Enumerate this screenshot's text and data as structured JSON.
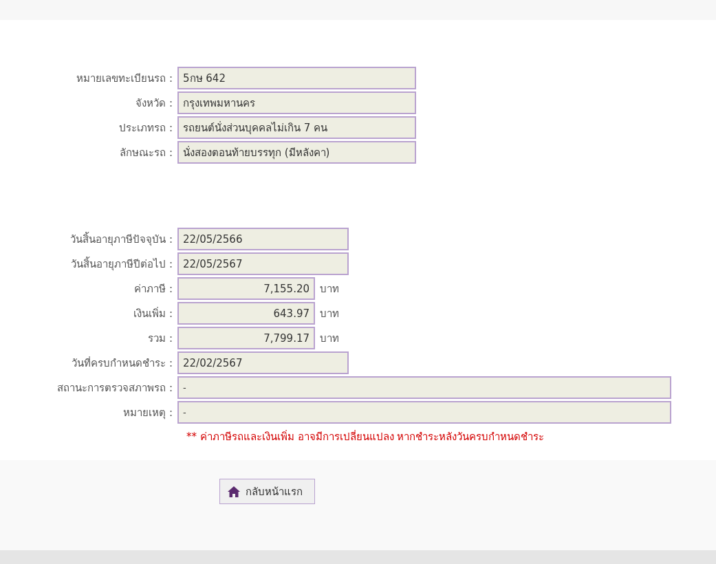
{
  "vehicle_info": [
    {
      "label": "หมายเลขทะเบียนรถ :",
      "value": "5กษ 642",
      "kind": "wide"
    },
    {
      "label": "จังหวัด :",
      "value": "กรุงเทพมหานคร",
      "kind": "wide"
    },
    {
      "label": "ประเภทรถ :",
      "value": "รถยนต์นั่งส่วนบุคคลไม่เกิน 7 คน",
      "kind": "wide"
    },
    {
      "label": "ลักษณะรถ :",
      "value": "นั่งสองตอนท้ายบรรทุก (มีหลังคา)",
      "kind": "wide"
    }
  ],
  "tax_info": [
    {
      "label": "วันสิ้นอายุภาษีปัจจุบัน :",
      "value": "22/05/2566",
      "kind": "date"
    },
    {
      "label": "วันสิ้นอายุภาษีปีต่อไป :",
      "value": "22/05/2567",
      "kind": "date"
    },
    {
      "label": "ค่าภาษี :",
      "value": "7,155.20",
      "kind": "money",
      "unit": "บาท"
    },
    {
      "label": "เงินเพิ่ม :",
      "value": "643.97",
      "kind": "money",
      "unit": "บาท"
    },
    {
      "label": "รวม :",
      "value": "7,799.17",
      "kind": "money",
      "unit": "บาท"
    },
    {
      "label": "วันที่ครบกำหนดชำระ :",
      "value": "22/02/2567",
      "kind": "date"
    },
    {
      "label": "สถานะการตรวจสภาพรถ :",
      "value": "-",
      "kind": "full"
    },
    {
      "label": "หมายเหตุ :",
      "value": "-",
      "kind": "full"
    }
  ],
  "notice": "** ค่าภาษีรถและเงินเพิ่ม อาจมีการเปลี่ยนแปลง หากชำระหลังวันครบกำหนดชำระ",
  "home_button": "กลับหน้าแรก"
}
